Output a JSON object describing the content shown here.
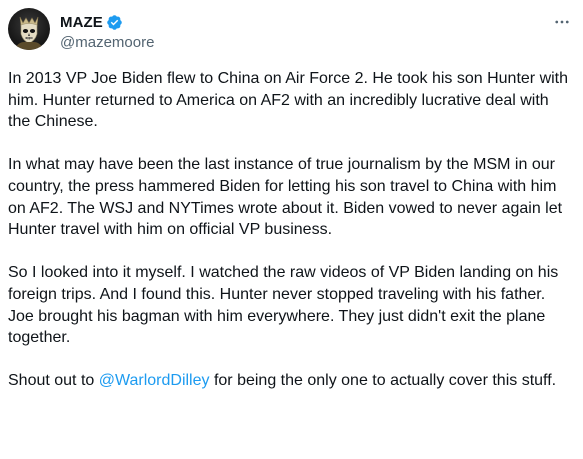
{
  "author": {
    "display_name": "MAZE",
    "handle": "@mazemoore",
    "verified": true,
    "avatar_icon": "skull-mask-avatar"
  },
  "menu_icon": "more-dots-icon",
  "colors": {
    "text": "#0f1419",
    "secondary": "#536471",
    "link": "#1d9bf0",
    "verified_badge": "#1d9bf0"
  },
  "tweet": {
    "p1": "In 2013 VP Joe Biden flew to China on Air Force 2. He took his son Hunter with him. Hunter returned to America on AF2 with an incredibly lucrative deal with the Chinese.",
    "p2": "In what may have been the last instance of true journalism by the MSM in our country, the press hammered Biden for letting his son travel to China with him on AF2. The WSJ and NYTimes wrote about it. Biden vowed to never again let Hunter travel with him on official VP business.",
    "p3": "So I looked into it myself. I watched the raw videos of VP Biden landing on his foreign trips. And I found this. Hunter never stopped traveling with his father. Joe brought his bagman with him everywhere. They just didn't exit the plane together.",
    "p4_before": "Shout out to ",
    "p4_mention": "@WarlordDilley",
    "p4_after": " for being the only one to actually cover this stuff."
  }
}
